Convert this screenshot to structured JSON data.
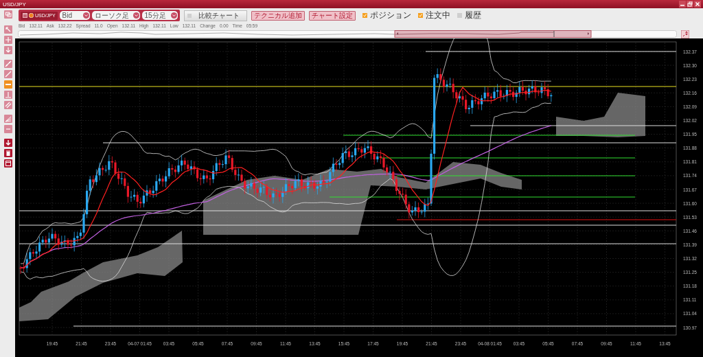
{
  "window": {
    "title": "USD/JPY"
  },
  "toolbar": {
    "instrument": "USD/JPY",
    "dropdowns": [
      {
        "value": "Bid"
      },
      {
        "value": "ローソク足"
      },
      {
        "value": "15分足"
      }
    ],
    "compare": {
      "label": "比較チャート",
      "checked": false
    },
    "buttons": [
      "テクニカル追加",
      "チャート設定"
    ],
    "toggles": [
      {
        "label": "ポジション",
        "checked": true
      },
      {
        "label": "注文中",
        "checked": true
      },
      {
        "label": "履歴",
        "checked": false
      }
    ]
  },
  "quote": [
    {
      "label": "Bid",
      "value": "132.11"
    },
    {
      "label": "Ask",
      "value": "132.22"
    },
    {
      "label": "Spread",
      "value": "11.0"
    },
    {
      "label": "Open",
      "value": "132.11"
    },
    {
      "label": "High",
      "value": "132.11"
    },
    {
      "label": "Low",
      "value": "132.11"
    },
    {
      "label": "Change",
      "value": "0.00"
    },
    {
      "label": "Time",
      "value": "05:59"
    }
  ],
  "tool_groups": [
    [
      {
        "kind": "cursor",
        "selected": false
      },
      {
        "kind": "crosshair",
        "selected": false
      },
      {
        "kind": "pan",
        "selected": false
      }
    ],
    [
      {
        "kind": "trendline",
        "selected": false
      },
      {
        "kind": "line",
        "selected": false
      },
      {
        "kind": "hline",
        "selected": true
      },
      {
        "kind": "vline",
        "selected": false
      },
      {
        "kind": "channel",
        "selected": false
      }
    ],
    [
      {
        "kind": "fan",
        "selected": false
      },
      {
        "kind": "minus",
        "selected": false
      }
    ],
    [
      {
        "kind": "download",
        "selected": false
      },
      {
        "kind": "trash",
        "selected": false
      },
      {
        "kind": "window",
        "selected": false
      }
    ]
  ],
  "chart": {
    "y_ticks": [
      "132.37",
      "132.30",
      "132.23",
      "132.16",
      "132.09",
      "132.02",
      "131.95",
      "131.88",
      "131.81",
      "131.74",
      "131.67",
      "131.60",
      "131.53",
      "131.46",
      "131.39",
      "131.32",
      "131.25",
      "131.18",
      "131.11",
      "131.04",
      "130.97"
    ],
    "x_ticks": [
      "19:45",
      "21:45",
      "23:45",
      "04-07 01:45",
      "03:45",
      "05:45",
      "07:45",
      "09:45",
      "11:45",
      "13:45",
      "15:45",
      "17:45",
      "19:45",
      "21:45",
      "23:45",
      "04-08 01:45",
      "03:45",
      "05:45",
      "07:45",
      "09:45",
      "11:45",
      "13:45"
    ]
  }
}
